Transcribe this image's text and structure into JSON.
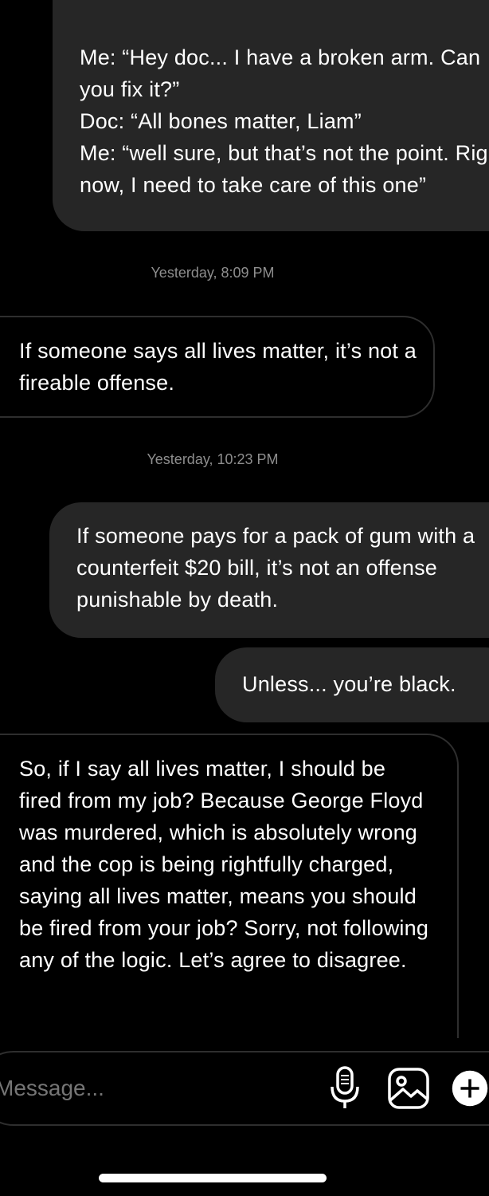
{
  "messages": [
    {
      "id": "msg1",
      "direction": "sent",
      "text": "Me: “Hey doc... I have a broken arm. Can you fix it?”\nDoc: “All bones matter, Liam”\nMe: “well sure, but that’s not the point. Right now, I need to take care of this one”"
    },
    {
      "id": "ts1",
      "timestamp": "Yesterday, 8:09 PM"
    },
    {
      "id": "msg2",
      "direction": "received",
      "text": "If someone says all lives matter, it’s not a fireable offense."
    },
    {
      "id": "ts2",
      "timestamp": "Yesterday, 10:23 PM"
    },
    {
      "id": "msg3",
      "direction": "sent",
      "text": "If someone pays for a pack of gum with a counterfeit $20 bill, it’s not an offense punishable by death."
    },
    {
      "id": "msg4",
      "direction": "sent",
      "text": "Unless... you’re black."
    },
    {
      "id": "msg5",
      "direction": "received",
      "text": "So, if I say all lives matter, I should be fired from my job? Because George Floyd was murdered, which is absolutely wrong and the cop is being rightfully charged, saying all lives matter, means you should be fired from your job? Sorry, not following any of the logic. Let’s agree to disagree."
    }
  ],
  "composer": {
    "placeholder": "Message...",
    "icons": [
      "microphone-icon",
      "image-icon",
      "plus-icon"
    ]
  },
  "colors": {
    "background": "#000000",
    "sent_bubble": "#262626",
    "received_border": "#2e2e2e",
    "timestamp_text": "#8e8e8e"
  }
}
